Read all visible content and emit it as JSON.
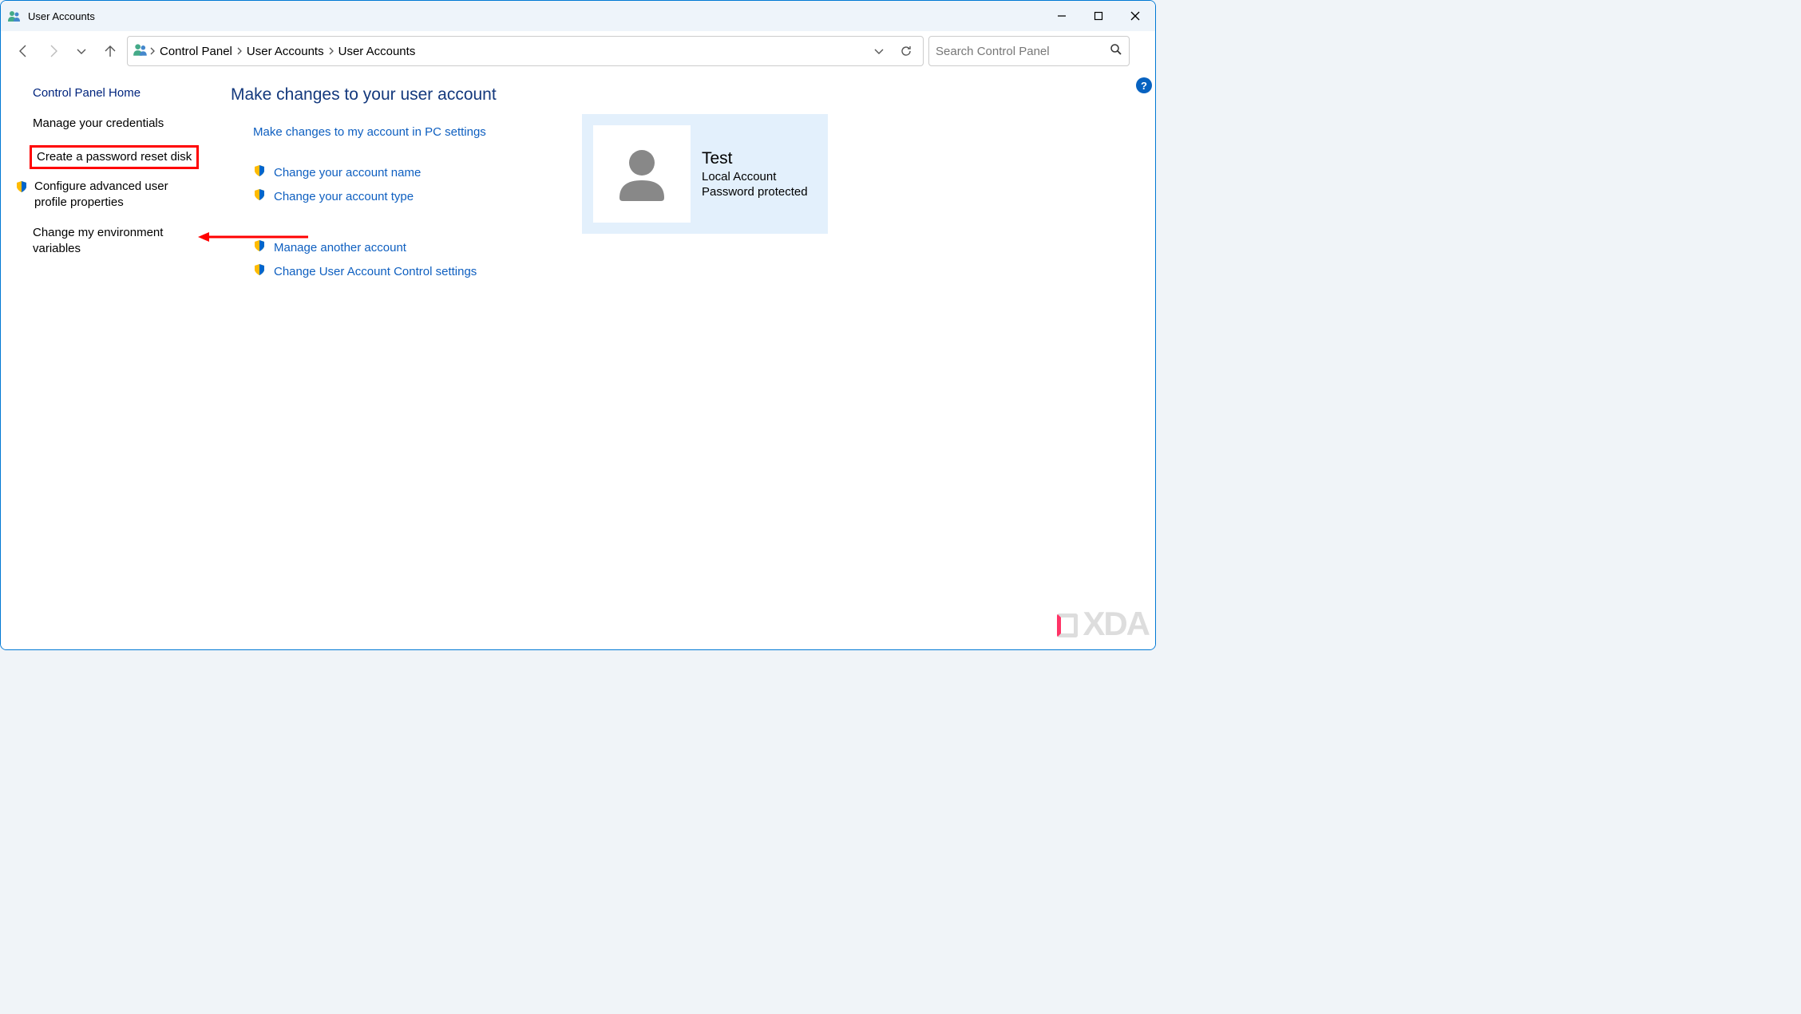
{
  "window": {
    "title": "User Accounts"
  },
  "breadcrumb": {
    "items": [
      "Control Panel",
      "User Accounts",
      "User Accounts"
    ]
  },
  "search": {
    "placeholder": "Search Control Panel"
  },
  "sidebar": {
    "home": "Control Panel Home",
    "items": [
      {
        "label": "Manage your credentials",
        "shield": false
      },
      {
        "label": "Create a password reset disk",
        "shield": false,
        "highlighted": true
      },
      {
        "label": "Configure advanced user profile properties",
        "shield": true
      },
      {
        "label": "Change my environment variables",
        "shield": false
      }
    ]
  },
  "main": {
    "heading": "Make changes to your user account",
    "pc_settings_link": "Make changes to my account in PC settings",
    "actions_group1": [
      {
        "label": "Change your account name",
        "shield": true
      },
      {
        "label": "Change your account type",
        "shield": true
      }
    ],
    "actions_group2": [
      {
        "label": "Manage another account",
        "shield": true
      },
      {
        "label": "Change User Account Control settings",
        "shield": true
      }
    ]
  },
  "user_card": {
    "name": "Test",
    "type": "Local Account",
    "status": "Password protected"
  },
  "watermark": "XDA"
}
